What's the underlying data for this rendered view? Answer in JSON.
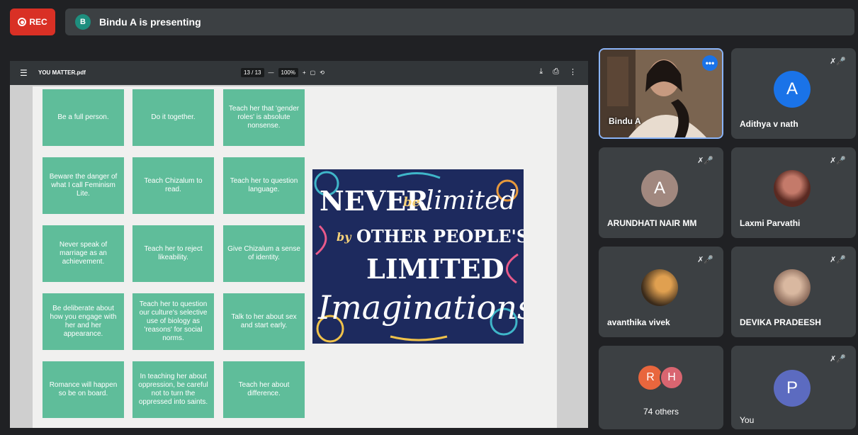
{
  "recording": {
    "label": "REC"
  },
  "presenter_bar": {
    "initial": "B",
    "text": "Bindu A is presenting"
  },
  "pdf_toolbar": {
    "file_name": "YOU MATTER.pdf",
    "page_current": "13",
    "page_separator": "/",
    "page_total": "13",
    "zoom_minus": "—",
    "zoom": "100%",
    "zoom_plus": "+"
  },
  "cards": [
    "Be a full person.",
    "Do it together.",
    "Teach her that 'gender roles' is absolute nonsense.",
    "Beware the danger of what I call Feminism Lite.",
    "Teach Chizalum to read.",
    "Teach her to question language.",
    "Never speak of marriage as an achievement.",
    "Teach her to reject likeability.",
    "Give Chizalum a sense of identity.",
    "Be deliberate about how you engage with her and her appearance.",
    "Teach her to question our culture's selective use of biology as 'reasons' for social norms.",
    "Talk to her about sex and start early.",
    "Romance will happen so be on board.",
    "In teaching her about oppression, be careful not to turn the oppressed into saints.",
    "Teach her about difference."
  ],
  "poster": {
    "line1a": "NEVER",
    "line1b": "be",
    "line1c": "limited",
    "line2a": "by",
    "line2b": "OTHER PEOPLE'S",
    "line3": "LIMITED",
    "line4": "Imaginations"
  },
  "participants": [
    {
      "name": "Bindu A",
      "muted": false
    },
    {
      "name": "Adithya v nath",
      "initial": "A",
      "color": "#1a73e8",
      "muted": true
    },
    {
      "name": "ARUNDHATI NAIR MM",
      "initial": "A",
      "color": "#a1887f",
      "muted": true
    },
    {
      "name": "Laxmi Parvathi",
      "muted": true
    },
    {
      "name": "avanthika vivek",
      "muted": true
    },
    {
      "name": "DEVIKA PRADEESH",
      "muted": true
    },
    {
      "name": "You",
      "initial": "P",
      "color": "#5c6bc0",
      "muted": true
    }
  ],
  "others": {
    "count_label": "74 others",
    "initial1": "R",
    "color1": "#e8663d",
    "initial2": "H",
    "color2": "#d96570"
  },
  "icons": {
    "mic_off": "mic-off-icon",
    "more": "more-options-icon"
  }
}
